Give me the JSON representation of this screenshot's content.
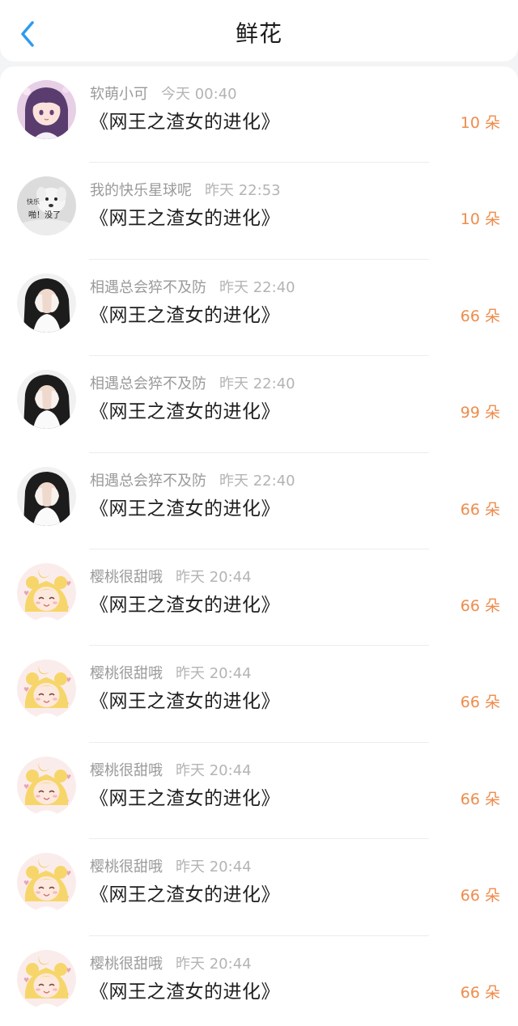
{
  "header": {
    "title": "鲜花",
    "back_icon": "chevron-left-icon",
    "accent_color": "#2e9bf0"
  },
  "colors": {
    "quantity": "#ee8c4c",
    "name": "#9a9a9a",
    "time": "#b4b4b4"
  },
  "gifts": [
    {
      "user": "软萌小可",
      "time": "今天 00:40",
      "book": "《网王之渣女的进化》",
      "amount": "10 朵",
      "avatar": "anime-girl-purple-avatar"
    },
    {
      "user": "我的快乐星球呢",
      "time": "昨天 22:53",
      "book": "《网王之渣女的进化》",
      "amount": "10 朵",
      "avatar": "dog-meme-avatar",
      "avatar_text": [
        "快乐",
        "啪！没了"
      ]
    },
    {
      "user": "相遇总会猝不及防",
      "time": "昨天 22:40",
      "book": "《网王之渣女的进化》",
      "amount": "66 朵",
      "avatar": "girl-covering-face-avatar"
    },
    {
      "user": "相遇总会猝不及防",
      "time": "昨天 22:40",
      "book": "《网王之渣女的进化》",
      "amount": "99 朵",
      "avatar": "girl-covering-face-avatar"
    },
    {
      "user": "相遇总会猝不及防",
      "time": "昨天 22:40",
      "book": "《网王之渣女的进化》",
      "amount": "66 朵",
      "avatar": "girl-covering-face-avatar"
    },
    {
      "user": "樱桃很甜哦",
      "time": "昨天 20:44",
      "book": "《网王之渣女的进化》",
      "amount": "66 朵",
      "avatar": "sailor-moon-avatar"
    },
    {
      "user": "樱桃很甜哦",
      "time": "昨天 20:44",
      "book": "《网王之渣女的进化》",
      "amount": "66 朵",
      "avatar": "sailor-moon-avatar"
    },
    {
      "user": "樱桃很甜哦",
      "time": "昨天 20:44",
      "book": "《网王之渣女的进化》",
      "amount": "66 朵",
      "avatar": "sailor-moon-avatar"
    },
    {
      "user": "樱桃很甜哦",
      "time": "昨天 20:44",
      "book": "《网王之渣女的进化》",
      "amount": "66 朵",
      "avatar": "sailor-moon-avatar"
    },
    {
      "user": "樱桃很甜哦",
      "time": "昨天 20:44",
      "book": "《网王之渣女的进化》",
      "amount": "66 朵",
      "avatar": "sailor-moon-avatar"
    }
  ]
}
